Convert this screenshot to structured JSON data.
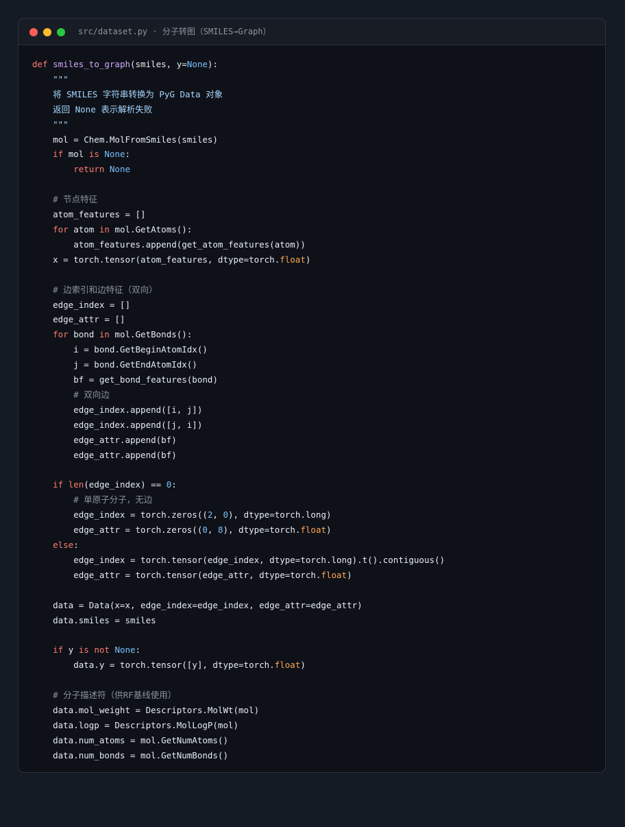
{
  "window": {
    "title": "src/dataset.py · 分子转图（SMILES→Graph）"
  },
  "code_lines": [
    [
      [
        "kw",
        "def"
      ],
      [
        "t",
        " "
      ],
      [
        "fn",
        "smiles_to_graph"
      ],
      [
        "t",
        "(smiles, y="
      ],
      [
        "con",
        "None"
      ],
      [
        "t",
        "):"
      ]
    ],
    [
      [
        "t",
        "    "
      ],
      [
        "st",
        "\"\"\""
      ]
    ],
    [
      [
        "t",
        "    "
      ],
      [
        "st",
        "将 SMILES 字符串转换为 PyG Data 对象"
      ]
    ],
    [
      [
        "t",
        "    "
      ],
      [
        "st",
        "返回 None 表示解析失败"
      ]
    ],
    [
      [
        "t",
        "    "
      ],
      [
        "st",
        "\"\"\""
      ]
    ],
    [
      [
        "t",
        "    mol = Chem.MolFromSmiles(smiles)"
      ]
    ],
    [
      [
        "t",
        "    "
      ],
      [
        "kw",
        "if"
      ],
      [
        "t",
        " mol "
      ],
      [
        "kw",
        "is"
      ],
      [
        "t",
        " "
      ],
      [
        "con",
        "None"
      ],
      [
        "t",
        ":"
      ]
    ],
    [
      [
        "t",
        "        "
      ],
      [
        "kw",
        "return"
      ],
      [
        "t",
        " "
      ],
      [
        "con",
        "None"
      ]
    ],
    [
      [
        "t",
        ""
      ]
    ],
    [
      [
        "t",
        "    "
      ],
      [
        "cm",
        "# 节点特征"
      ]
    ],
    [
      [
        "t",
        "    atom_features = []"
      ]
    ],
    [
      [
        "t",
        "    "
      ],
      [
        "kw",
        "for"
      ],
      [
        "t",
        " atom "
      ],
      [
        "kw",
        "in"
      ],
      [
        "t",
        " mol.GetAtoms():"
      ]
    ],
    [
      [
        "t",
        "        atom_features.append(get_atom_features(atom))"
      ]
    ],
    [
      [
        "t",
        "    x = torch.tensor(atom_features, dtype=torch."
      ],
      [
        "ty",
        "float"
      ],
      [
        "t",
        ")"
      ]
    ],
    [
      [
        "t",
        ""
      ]
    ],
    [
      [
        "t",
        "    "
      ],
      [
        "cm",
        "# 边索引和边特征（双向）"
      ]
    ],
    [
      [
        "t",
        "    edge_index = []"
      ]
    ],
    [
      [
        "t",
        "    edge_attr = []"
      ]
    ],
    [
      [
        "t",
        "    "
      ],
      [
        "kw",
        "for"
      ],
      [
        "t",
        " bond "
      ],
      [
        "kw",
        "in"
      ],
      [
        "t",
        " mol.GetBonds():"
      ]
    ],
    [
      [
        "t",
        "        i = bond.GetBeginAtomIdx()"
      ]
    ],
    [
      [
        "t",
        "        j = bond.GetEndAtomIdx()"
      ]
    ],
    [
      [
        "t",
        "        bf = get_bond_features(bond)"
      ]
    ],
    [
      [
        "t",
        "        "
      ],
      [
        "cm",
        "# 双向边"
      ]
    ],
    [
      [
        "t",
        "        edge_index.append([i, j])"
      ]
    ],
    [
      [
        "t",
        "        edge_index.append([j, i])"
      ]
    ],
    [
      [
        "t",
        "        edge_attr.append(bf)"
      ]
    ],
    [
      [
        "t",
        "        edge_attr.append(bf)"
      ]
    ],
    [
      [
        "t",
        ""
      ]
    ],
    [
      [
        "t",
        "    "
      ],
      [
        "kw",
        "if"
      ],
      [
        "t",
        " "
      ],
      [
        "kw",
        "len"
      ],
      [
        "t",
        "(edge_index) == "
      ],
      [
        "num",
        "0"
      ],
      [
        "t",
        ":"
      ]
    ],
    [
      [
        "t",
        "        "
      ],
      [
        "cm",
        "# 单原子分子，无边"
      ]
    ],
    [
      [
        "t",
        "        edge_index = torch.zeros(("
      ],
      [
        "num",
        "2"
      ],
      [
        "t",
        ", "
      ],
      [
        "num",
        "0"
      ],
      [
        "t",
        "), dtype=torch.long)"
      ]
    ],
    [
      [
        "t",
        "        edge_attr = torch.zeros(("
      ],
      [
        "num",
        "0"
      ],
      [
        "t",
        ", "
      ],
      [
        "num",
        "8"
      ],
      [
        "t",
        "), dtype=torch."
      ],
      [
        "ty",
        "float"
      ],
      [
        "t",
        ")"
      ]
    ],
    [
      [
        "t",
        "    "
      ],
      [
        "kw",
        "else"
      ],
      [
        "t",
        ":"
      ]
    ],
    [
      [
        "t",
        "        edge_index = torch.tensor(edge_index, dtype=torch.long).t().contiguous()"
      ]
    ],
    [
      [
        "t",
        "        edge_attr = torch.tensor(edge_attr, dtype=torch."
      ],
      [
        "ty",
        "float"
      ],
      [
        "t",
        ")"
      ]
    ],
    [
      [
        "t",
        ""
      ]
    ],
    [
      [
        "t",
        "    data = Data(x=x, edge_index=edge_index, edge_attr=edge_attr)"
      ]
    ],
    [
      [
        "t",
        "    data.smiles = smiles"
      ]
    ],
    [
      [
        "t",
        ""
      ]
    ],
    [
      [
        "t",
        "    "
      ],
      [
        "kw",
        "if"
      ],
      [
        "t",
        " y "
      ],
      [
        "kw",
        "is not"
      ],
      [
        "t",
        " "
      ],
      [
        "con",
        "None"
      ],
      [
        "t",
        ":"
      ]
    ],
    [
      [
        "t",
        "        data.y = torch.tensor([y], dtype=torch."
      ],
      [
        "ty",
        "float"
      ],
      [
        "t",
        ")"
      ]
    ],
    [
      [
        "t",
        ""
      ]
    ],
    [
      [
        "t",
        "    "
      ],
      [
        "cm",
        "# 分子描述符（供RF基线使用）"
      ]
    ],
    [
      [
        "t",
        "    data.mol_weight = Descriptors.MolWt(mol)"
      ]
    ],
    [
      [
        "t",
        "    data.logp = Descriptors.MolLogP(mol)"
      ]
    ],
    [
      [
        "t",
        "    data.num_atoms = mol.GetNumAtoms()"
      ]
    ],
    [
      [
        "t",
        "    data.num_bonds = mol.GetNumBonds()"
      ]
    ]
  ]
}
